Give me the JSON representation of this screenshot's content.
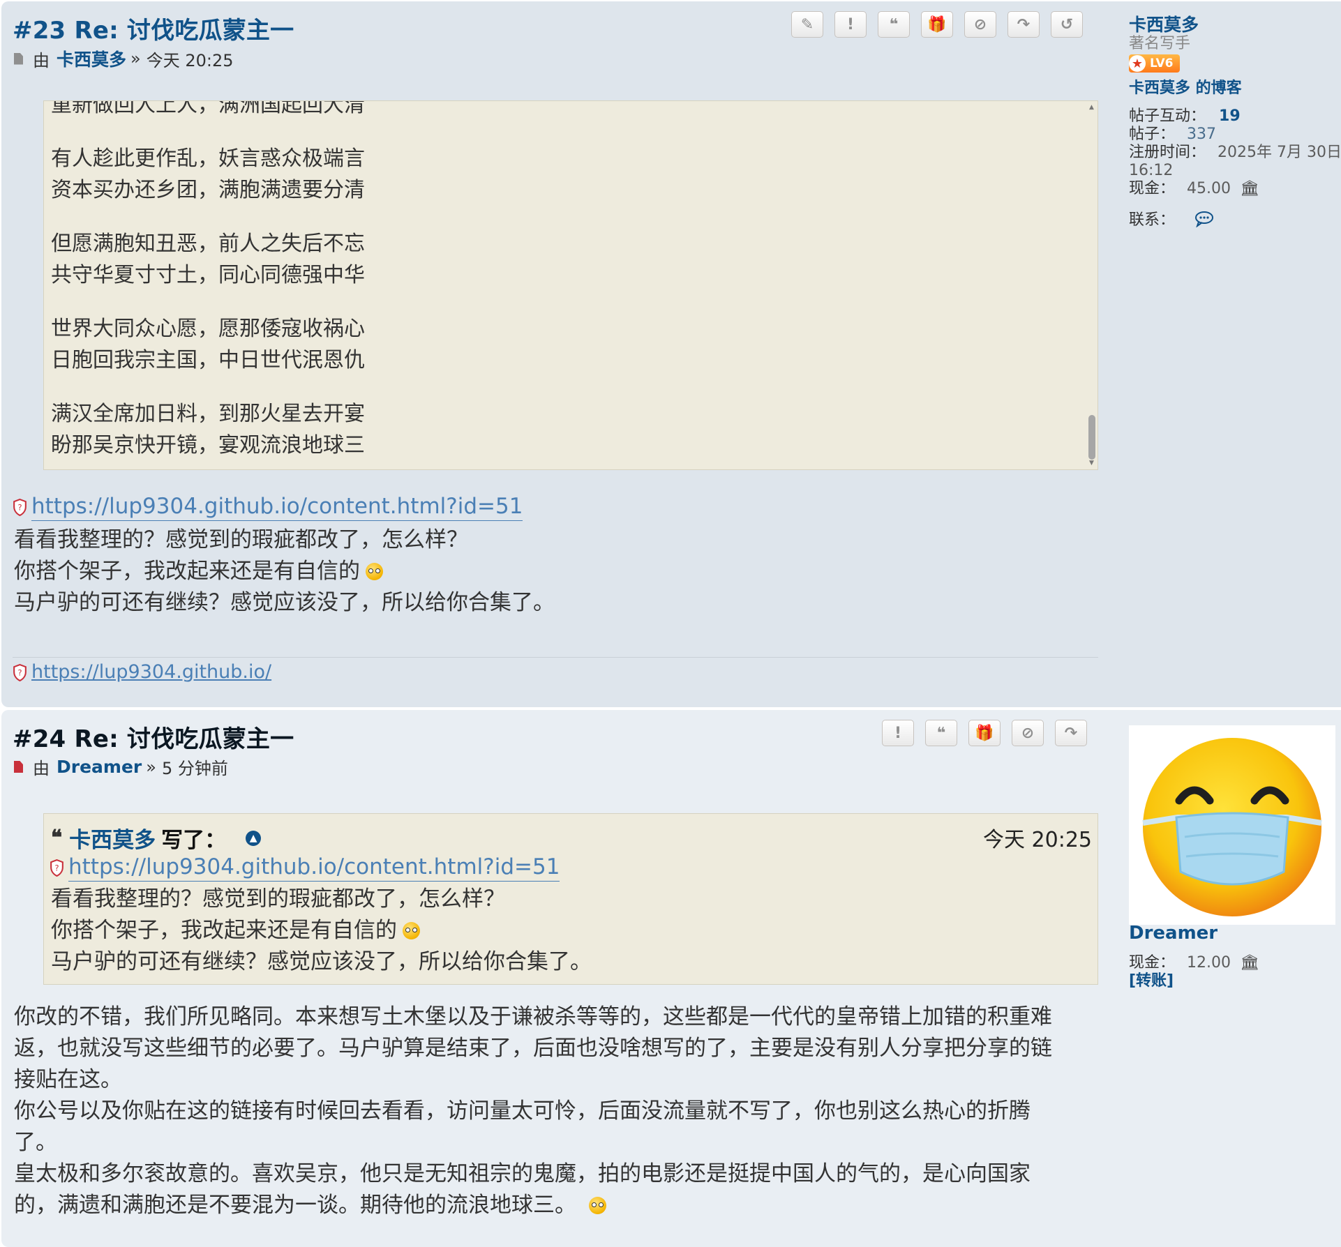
{
  "post23": {
    "title": "#23 Re: 讨伐吃瓜蒙主一",
    "by_label": "由",
    "author": "卡西莫多",
    "sep": "»",
    "time": "今天 20:25",
    "buttons": [
      {
        "name": "edit-button",
        "icon": "pencil-icon",
        "glyph": "✎"
      },
      {
        "name": "report-button",
        "icon": "exclamation-icon",
        "glyph": "!"
      },
      {
        "name": "quote-button",
        "icon": "quote-icon",
        "glyph": "❝"
      },
      {
        "name": "gift-button",
        "icon": "gift-icon",
        "glyph": "🎁"
      },
      {
        "name": "ban-button",
        "icon": "ban-icon",
        "glyph": "⊘"
      },
      {
        "name": "share-button",
        "icon": "share-icon",
        "glyph": "↷"
      },
      {
        "name": "history-button",
        "icon": "history-icon",
        "glyph": "↺"
      }
    ],
    "poem": [
      [
        "重新做回人上人，满洲国起回大清"
      ],
      [
        "有人趁此更作乱，妖言惑众极端言",
        "资本买办还乡团，满胞满遗要分清"
      ],
      [
        "但愿满胞知丑恶，前人之失后不忘",
        "共守华夏寸寸土，同心同德强中华"
      ],
      [
        "世界大同众心愿，愿那倭寇收祸心",
        "日胞回我宗主国，中日世代泯恩仇"
      ],
      [
        "满汉全席加日料，到那火星去开宴",
        "盼那吴京快开镜，宴观流浪地球三"
      ]
    ],
    "link": "https://lup9304.github.io/content.html?id=51",
    "lines": [
      "看看我整理的？感觉到的瑕疵都改了，怎么样？",
      "你搭个架子，我改起来还是有自信的",
      "马户驴的可还有继续？感觉应该没了，所以给你合集了。"
    ],
    "signature_link": "https://lup9304.github.io/"
  },
  "profile23": {
    "name": "卡西莫多",
    "rank": "著名写手",
    "level": "LV6",
    "blog": "卡西莫多 的博客",
    "interact_label": "帖子互动：",
    "interact_value": "19",
    "posts_label": "帖子：",
    "posts_value": "337",
    "joined_label": "注册时间：",
    "joined_value": "2025年 7月 30日",
    "joined_time": "16:12",
    "cash_label": "现金：",
    "cash_value": "45.00",
    "contact_label": "联系："
  },
  "post24": {
    "title": "#24 Re: 讨伐吃瓜蒙主一",
    "by_label": "由",
    "author": "Dreamer",
    "sep": "»",
    "time": "5 分钟前",
    "buttons": [
      {
        "name": "report-button",
        "icon": "exclamation-icon",
        "glyph": "!"
      },
      {
        "name": "quote-button",
        "icon": "quote-icon",
        "glyph": "❝"
      },
      {
        "name": "gift-button",
        "icon": "gift-icon",
        "glyph": "🎁"
      },
      {
        "name": "ban-button",
        "icon": "ban-icon",
        "glyph": "⊘"
      },
      {
        "name": "share-button",
        "icon": "share-icon",
        "glyph": "↷"
      }
    ],
    "quote": {
      "author": "卡西莫多",
      "wrote": "写了：",
      "time": "今天 20:25",
      "link": "https://lup9304.github.io/content.html?id=51",
      "lines": [
        "看看我整理的？感觉到的瑕疵都改了，怎么样？",
        "你搭个架子，我改起来还是有自信的",
        "马户驴的可还有继续？感觉应该没了，所以给你合集了。"
      ]
    },
    "lines": [
      "你改的不错，我们所见略同。本来想写土木堡以及于谦被杀等等的，这些都是一代代的皇帝错上加错的积重难",
      "返，也就没写这些细节的必要了。马户驴算是结束了，后面也没啥想写的了，主要是没有别人分享把分享的链",
      "接贴在这。",
      "你公号以及你贴在这的链接有时候回去看看，访问量太可怜，后面没流量就不写了，你也别这么热心的折腾",
      "了。",
      "皇太极和多尔衮故意的。喜欢吴京，他只是无知祖宗的鬼魔，拍的电影还是挺提中国人的气的，是心向国家",
      "的，满遗和满胞还是不要混为一谈。期待他的流浪地球三。"
    ]
  },
  "profile24": {
    "name": "Dreamer",
    "cash_label": "现金：",
    "cash_value": "12.00",
    "transfer": "[转账]"
  },
  "icons": {
    "shield": "shield-icon",
    "bank": "bank-icon",
    "chat": "chat-bubble-icon",
    "emoji": "smiley-icon"
  },
  "colors": {
    "post_bg": "#dee5ec",
    "link": "#105289",
    "code_bg": "#eeebdd",
    "badge": "#ff7a1a"
  }
}
